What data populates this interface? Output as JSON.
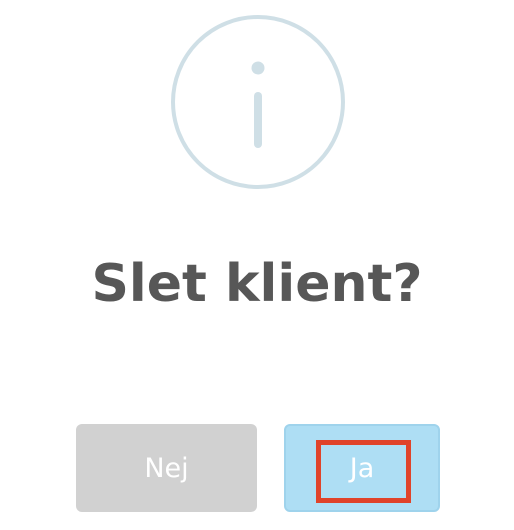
{
  "dialog": {
    "icon": "info-icon",
    "title": "Slet klient?",
    "cancel_label": "Nej",
    "confirm_label": "Ja"
  },
  "colors": {
    "icon_stroke": "#cfdfe6",
    "title_text": "#575757",
    "cancel_bg": "#d1d1d1",
    "confirm_bg": "#aedef4",
    "highlight": "#e0432a"
  }
}
